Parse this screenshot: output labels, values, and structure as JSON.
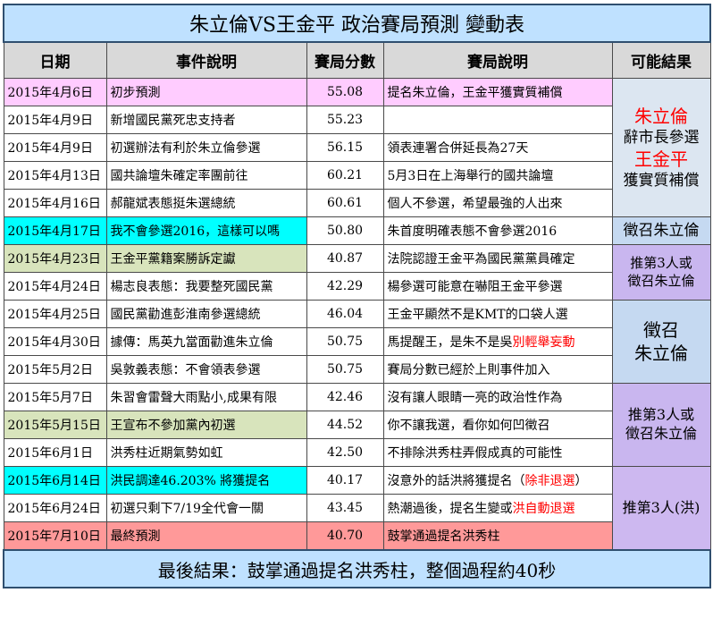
{
  "title": "朱立倫VS王金平 政治賽局預測 變動表",
  "headers": [
    "日期",
    "事件說明",
    "賽局分數",
    "賽局說明",
    "可能結果"
  ],
  "rows": [
    {
      "date": "2015年4月6日",
      "event": "初步預測",
      "score": "55.08",
      "desc": "提名朱立倫，王金平獲實質補償"
    },
    {
      "date": "2015年4月9日",
      "event": "新增國民黨死忠支持者",
      "score": "55.23",
      "desc": ""
    },
    {
      "date": "2015年4月9日",
      "event": "初選辦法有利於朱立倫參選",
      "score": "56.15",
      "desc": "領表連署合併延長為27天"
    },
    {
      "date": "2015年4月13日",
      "event": "國共論壇朱確定率團前往",
      "score": "60.21",
      "desc": "5月3日在上海舉行的國共論壇"
    },
    {
      "date": "2015年4月16日",
      "event": "郝龍斌表態挺朱選總統",
      "score": "60.61",
      "desc": "個人不參選，希望最強的人出來"
    },
    {
      "date": "2015年4月17日",
      "event": "我不會參選2016，這樣可以嗎",
      "score": "50.80",
      "desc": "朱首度明確表態不會參選2016"
    },
    {
      "date": "2015年4月23日",
      "event": "王金平黨籍案勝訴定讞",
      "score": "40.87",
      "desc": "法院認證王金平為國民黨黨員確定"
    },
    {
      "date": "2015年4月24日",
      "event": "楊志良表態：我要整死國民黨",
      "score": "42.29",
      "desc": "楊參選可能意在嚇阻王金平參選"
    },
    {
      "date": "2015年4月25日",
      "event": "國民黨勸進彭淮南參選總統",
      "score": "46.04",
      "desc": "王金平顯然不是KMT的口袋人選"
    },
    {
      "date": "2015年4月30日",
      "event": "據傳：馬英九當面勸進朱立倫",
      "score": "50.75",
      "desc": "馬提醒王，是朱不是吳",
      "desc_red": "別輕舉妄動"
    },
    {
      "date": "2015年5月2日",
      "event": "吳敦義表態：不會領表參選",
      "score": "50.75",
      "desc": "賽局分數已經於上則事件加入"
    },
    {
      "date": "2015年5月7日",
      "event": "朱習會雷聲大雨點小,成果有限",
      "score": "42.46",
      "desc": "沒有讓人眼睛一亮的政治性作為"
    },
    {
      "date": "2015年5月15日",
      "event": "王宣布不參加黨內初選",
      "score": "44.52",
      "desc": "你不讓我選，看你如何凹徵召"
    },
    {
      "date": "2015年6月1日",
      "event": "洪秀柱近期氣勢如虹",
      "score": "42.50",
      "desc": "不排除洪秀柱弄假成真的可能性"
    },
    {
      "date": "2015年6月14日",
      "event": "洪民調達46.203% 將獲提名",
      "score": "40.17",
      "desc": "沒意外的話洪將獲提名（",
      "desc_red": "除非退選",
      "desc_tail": "）"
    },
    {
      "date": "2015年6月24日",
      "event": "初選只剩下7/19全代會一關",
      "score": "43.45",
      "desc": "熱潮過後，提名生變或",
      "desc_red": "洪自動退選"
    },
    {
      "date": "2015年7月10日",
      "event": "最終預測",
      "score": "40.70",
      "desc": "鼓掌通過提名洪秀柱"
    }
  ],
  "results": {
    "g1_l1": "朱立倫",
    "g1_l2": "辭市長參選",
    "g1_l3": "王金平",
    "g1_l4": "獲實質補償",
    "g2": "徵召朱立倫",
    "g3_l1": "推第3人或",
    "g3_l2": "徵召朱立倫",
    "g4_l1": "徵召",
    "g4_l2": "朱立倫",
    "g5_l1": "推第3人或",
    "g5_l2": "徵召朱立倫",
    "g6": "推第3人(洪)"
  },
  "footer": "最後結果：鼓掌通過提名洪秀柱，整個過程約40秒",
  "colors": {
    "title_bg": "#bfe1ff",
    "header_bg": "#d9d9d9",
    "pink": "#ffccff",
    "cyan": "#00ffff",
    "olive": "#d8e4bc",
    "salmon": "#ff9999",
    "red_text": "#ff0000",
    "purple": "#c9b6ef",
    "light_blue": "#dce6f1"
  }
}
